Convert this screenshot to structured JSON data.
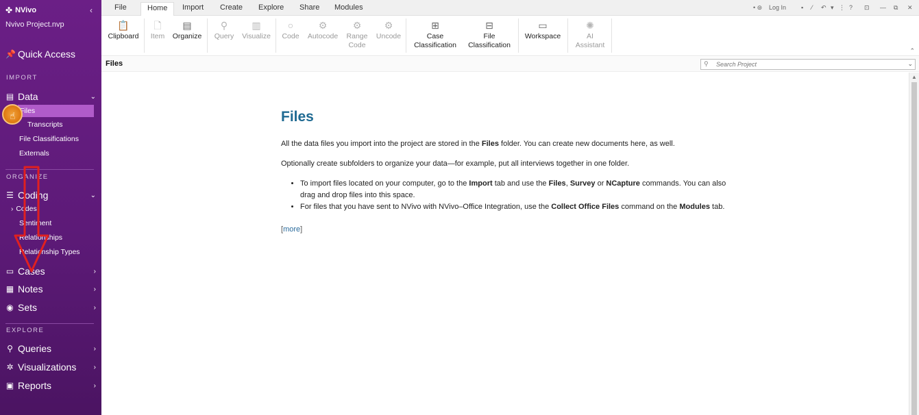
{
  "app": {
    "name": "NVivo",
    "project": "Nvivo Project.nvp"
  },
  "sidebar": {
    "quick_access": "Quick Access",
    "sections": {
      "import": "IMPORT",
      "organize": "ORGANIZE",
      "explore": "EXPLORE"
    },
    "data": {
      "label": "Data",
      "items": [
        "Files",
        "Transcripts",
        "File Classifications",
        "Externals"
      ]
    },
    "coding": {
      "label": "Coding",
      "items": [
        "Codes",
        "Sentiment",
        "Relationships",
        "Relationship Types"
      ]
    },
    "cases": "Cases",
    "notes": "Notes",
    "sets": "Sets",
    "queries": "Queries",
    "visualizations": "Visualizations",
    "reports": "Reports"
  },
  "ribbon": {
    "tabs": [
      "File",
      "Home",
      "Import",
      "Create",
      "Explore",
      "Share",
      "Modules"
    ],
    "active_tab": "Home",
    "login": "Log In",
    "buttons": {
      "clipboard": "Clipboard",
      "item": "Item",
      "organize": "Organize",
      "query": "Query",
      "visualize": "Visualize",
      "code": "Code",
      "autocode": "Autocode",
      "range_code": "Range Code",
      "uncode": "Uncode",
      "case_classification": "Case Classification",
      "file_classification": "File Classification",
      "workspace": "Workspace",
      "ai_assistant": "AI Assistant"
    }
  },
  "header": {
    "title": "Files",
    "search_placeholder": "Search Project"
  },
  "content": {
    "heading": "Files",
    "para1_a": "All the data files you import into the project are stored in the ",
    "para1_b": "Files",
    "para1_c": " folder. You can create new documents here, as well.",
    "para2": "Optionally create subfolders to organize your data—for example, put all interviews together in one folder.",
    "bullet1": {
      "a": "To import files located on your computer, go to the ",
      "b": "Import",
      "c": " tab and use the ",
      "d": "Files",
      "e": ", ",
      "f": "Survey",
      "g": " or ",
      "h": "NCapture",
      "i": " commands. You can also drag and drop files into this space."
    },
    "bullet2": {
      "a": "For files that you have sent to NVivo with NVivo–Office Integration, use the ",
      "b": "Collect Office Files",
      "c": " command on the ",
      "d": "Modules",
      "e": " tab."
    },
    "more_link": "more"
  },
  "colors": {
    "sidebar": "#5d1a78",
    "active_item": "#b05bc9",
    "heading": "#1f6a92",
    "annotation_arrow": "#e02020",
    "cursor_highlight": "#e07e15"
  }
}
